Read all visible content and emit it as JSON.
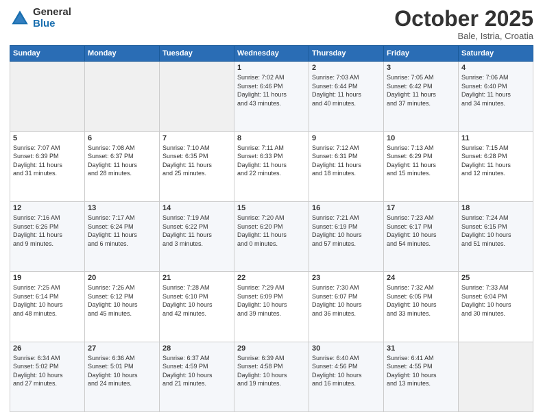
{
  "header": {
    "logo_general": "General",
    "logo_blue": "Blue",
    "month": "October 2025",
    "location": "Bale, Istria, Croatia"
  },
  "weekdays": [
    "Sunday",
    "Monday",
    "Tuesday",
    "Wednesday",
    "Thursday",
    "Friday",
    "Saturday"
  ],
  "weeks": [
    [
      {
        "day": "",
        "info": ""
      },
      {
        "day": "",
        "info": ""
      },
      {
        "day": "",
        "info": ""
      },
      {
        "day": "1",
        "info": "Sunrise: 7:02 AM\nSunset: 6:46 PM\nDaylight: 11 hours\nand 43 minutes."
      },
      {
        "day": "2",
        "info": "Sunrise: 7:03 AM\nSunset: 6:44 PM\nDaylight: 11 hours\nand 40 minutes."
      },
      {
        "day": "3",
        "info": "Sunrise: 7:05 AM\nSunset: 6:42 PM\nDaylight: 11 hours\nand 37 minutes."
      },
      {
        "day": "4",
        "info": "Sunrise: 7:06 AM\nSunset: 6:40 PM\nDaylight: 11 hours\nand 34 minutes."
      }
    ],
    [
      {
        "day": "5",
        "info": "Sunrise: 7:07 AM\nSunset: 6:39 PM\nDaylight: 11 hours\nand 31 minutes."
      },
      {
        "day": "6",
        "info": "Sunrise: 7:08 AM\nSunset: 6:37 PM\nDaylight: 11 hours\nand 28 minutes."
      },
      {
        "day": "7",
        "info": "Sunrise: 7:10 AM\nSunset: 6:35 PM\nDaylight: 11 hours\nand 25 minutes."
      },
      {
        "day": "8",
        "info": "Sunrise: 7:11 AM\nSunset: 6:33 PM\nDaylight: 11 hours\nand 22 minutes."
      },
      {
        "day": "9",
        "info": "Sunrise: 7:12 AM\nSunset: 6:31 PM\nDaylight: 11 hours\nand 18 minutes."
      },
      {
        "day": "10",
        "info": "Sunrise: 7:13 AM\nSunset: 6:29 PM\nDaylight: 11 hours\nand 15 minutes."
      },
      {
        "day": "11",
        "info": "Sunrise: 7:15 AM\nSunset: 6:28 PM\nDaylight: 11 hours\nand 12 minutes."
      }
    ],
    [
      {
        "day": "12",
        "info": "Sunrise: 7:16 AM\nSunset: 6:26 PM\nDaylight: 11 hours\nand 9 minutes."
      },
      {
        "day": "13",
        "info": "Sunrise: 7:17 AM\nSunset: 6:24 PM\nDaylight: 11 hours\nand 6 minutes."
      },
      {
        "day": "14",
        "info": "Sunrise: 7:19 AM\nSunset: 6:22 PM\nDaylight: 11 hours\nand 3 minutes."
      },
      {
        "day": "15",
        "info": "Sunrise: 7:20 AM\nSunset: 6:20 PM\nDaylight: 11 hours\nand 0 minutes."
      },
      {
        "day": "16",
        "info": "Sunrise: 7:21 AM\nSunset: 6:19 PM\nDaylight: 10 hours\nand 57 minutes."
      },
      {
        "day": "17",
        "info": "Sunrise: 7:23 AM\nSunset: 6:17 PM\nDaylight: 10 hours\nand 54 minutes."
      },
      {
        "day": "18",
        "info": "Sunrise: 7:24 AM\nSunset: 6:15 PM\nDaylight: 10 hours\nand 51 minutes."
      }
    ],
    [
      {
        "day": "19",
        "info": "Sunrise: 7:25 AM\nSunset: 6:14 PM\nDaylight: 10 hours\nand 48 minutes."
      },
      {
        "day": "20",
        "info": "Sunrise: 7:26 AM\nSunset: 6:12 PM\nDaylight: 10 hours\nand 45 minutes."
      },
      {
        "day": "21",
        "info": "Sunrise: 7:28 AM\nSunset: 6:10 PM\nDaylight: 10 hours\nand 42 minutes."
      },
      {
        "day": "22",
        "info": "Sunrise: 7:29 AM\nSunset: 6:09 PM\nDaylight: 10 hours\nand 39 minutes."
      },
      {
        "day": "23",
        "info": "Sunrise: 7:30 AM\nSunset: 6:07 PM\nDaylight: 10 hours\nand 36 minutes."
      },
      {
        "day": "24",
        "info": "Sunrise: 7:32 AM\nSunset: 6:05 PM\nDaylight: 10 hours\nand 33 minutes."
      },
      {
        "day": "25",
        "info": "Sunrise: 7:33 AM\nSunset: 6:04 PM\nDaylight: 10 hours\nand 30 minutes."
      }
    ],
    [
      {
        "day": "26",
        "info": "Sunrise: 6:34 AM\nSunset: 5:02 PM\nDaylight: 10 hours\nand 27 minutes."
      },
      {
        "day": "27",
        "info": "Sunrise: 6:36 AM\nSunset: 5:01 PM\nDaylight: 10 hours\nand 24 minutes."
      },
      {
        "day": "28",
        "info": "Sunrise: 6:37 AM\nSunset: 4:59 PM\nDaylight: 10 hours\nand 21 minutes."
      },
      {
        "day": "29",
        "info": "Sunrise: 6:39 AM\nSunset: 4:58 PM\nDaylight: 10 hours\nand 19 minutes."
      },
      {
        "day": "30",
        "info": "Sunrise: 6:40 AM\nSunset: 4:56 PM\nDaylight: 10 hours\nand 16 minutes."
      },
      {
        "day": "31",
        "info": "Sunrise: 6:41 AM\nSunset: 4:55 PM\nDaylight: 10 hours\nand 13 minutes."
      },
      {
        "day": "",
        "info": ""
      }
    ]
  ]
}
